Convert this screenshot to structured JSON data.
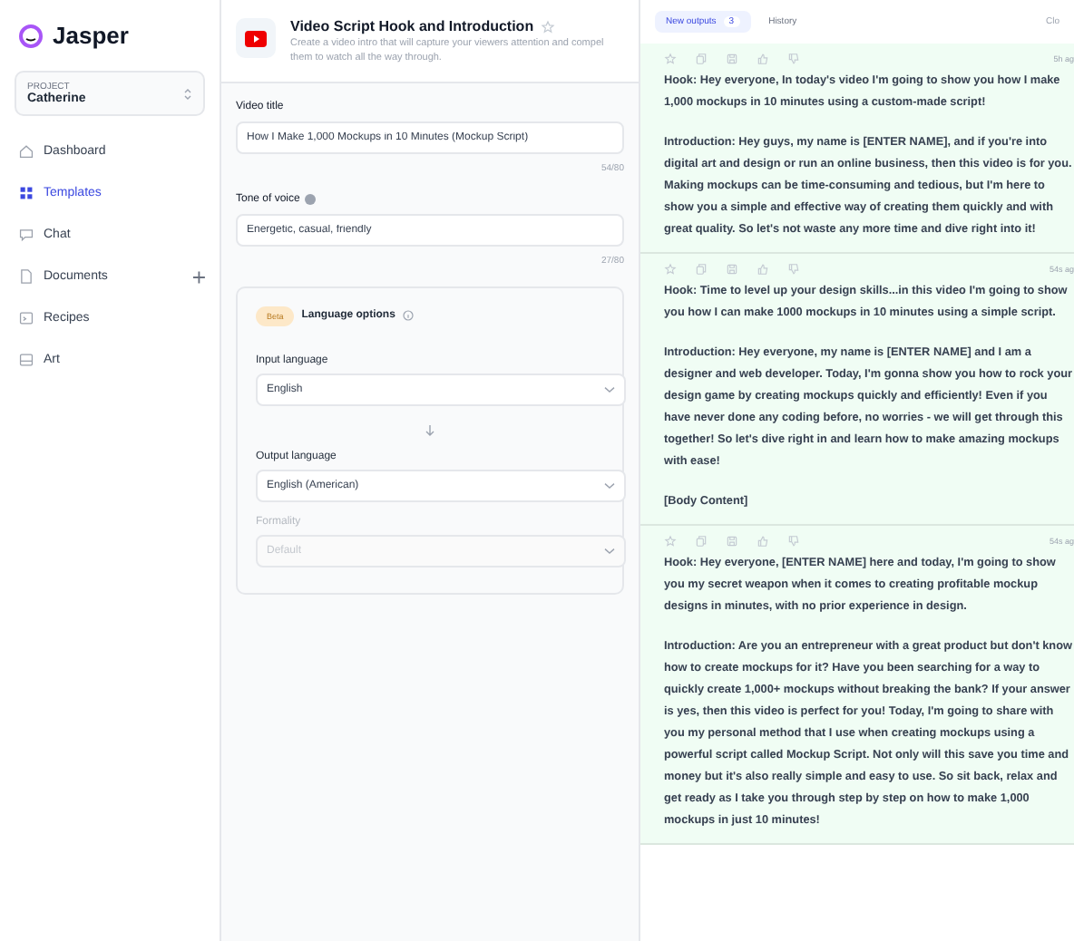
{
  "sidebar": {
    "brand": "Jasper",
    "project": {
      "label": "PROJECT",
      "name": "Catherine"
    },
    "items": [
      {
        "label": "Dashboard",
        "selected": false,
        "add": false
      },
      {
        "label": "Templates",
        "selected": true,
        "add": false
      },
      {
        "label": "Chat",
        "selected": false,
        "add": false
      },
      {
        "label": "Documents",
        "selected": false,
        "add": true
      },
      {
        "label": "Recipes",
        "selected": false,
        "add": false
      },
      {
        "label": "Art",
        "selected": false,
        "add": false
      }
    ]
  },
  "template": {
    "title": "Video Script Hook and Introduction",
    "description": "Create a video intro that will capture your viewers attention and compel them to watch all the way through."
  },
  "fields": [
    {
      "label": "Video title",
      "value": "How I Make 1,000 Mockups in 10 Minutes (Mockup Script)",
      "counter": "54/80",
      "info": false
    },
    {
      "label": "Tone of voice",
      "value": "Energetic, casual, friendly",
      "counter": "27/80",
      "info": true
    }
  ],
  "language_options": {
    "badge": "Beta",
    "title": "Language options",
    "selects": [
      {
        "label": "Input language",
        "value": "English",
        "disabled": false
      },
      {
        "label": "Output language",
        "value": "English (American)",
        "disabled": false
      },
      {
        "label": "Formality",
        "value": "Default",
        "disabled": true
      }
    ]
  },
  "output_tabs": [
    {
      "label": "New outputs",
      "count": "3",
      "selected": true
    },
    {
      "label": "History",
      "selected": false
    }
  ],
  "clear": "Clo",
  "outputs": [
    {
      "time": "5h ag",
      "paragraphs": [
        "Hook: Hey everyone, In today's video I'm going to show you how I make 1,000 mockups in 10 minutes using a custom-made script!",
        "Introduction: Hey guys, my name is [ENTER NAME], and if you're into digital art and design or run an online business, then this video is for you. Making mockups can be time-consuming and tedious, but I'm here to show you a simple and effective way of creating them quickly and with great quality. So let's not waste any more time and dive right into it!"
      ]
    },
    {
      "time": "54s ag",
      "paragraphs": [
        "Hook: Time to level up your design skills...in this video I'm going to show you how I can make 1000 mockups in 10 minutes using a simple script.",
        "Introduction: Hey everyone, my name is [ENTER NAME] and I am a designer and web developer. Today, I'm gonna show you how to rock your design game by creating mockups quickly and efficiently! Even if you have never done any coding before, no worries - we will get through this together! So let's dive right in and learn how to make amazing mockups with ease!",
        "[Body Content]"
      ]
    },
    {
      "time": "54s ag",
      "paragraphs": [
        "Hook: Hey everyone, [ENTER NAME] here and today, I'm going to show you my secret weapon when it comes to creating profitable mockup designs in minutes, with no prior experience in design.",
        "Introduction: Are you an entrepreneur with a great product but don't know how to create mockups for it? Have you been searching for a way to quickly create 1,000+ mockups without breaking the bank? If your answer is yes, then this video is perfect for you! Today, I'm going to share with you my personal method that I use when creating mockups using a powerful script called Mockup Script. Not only will this save you time and money but it's also really simple and easy to use. So sit back, relax and get ready as I take you through step by step on how to make 1,000 mockups in just 10 minutes!"
      ]
    }
  ]
}
